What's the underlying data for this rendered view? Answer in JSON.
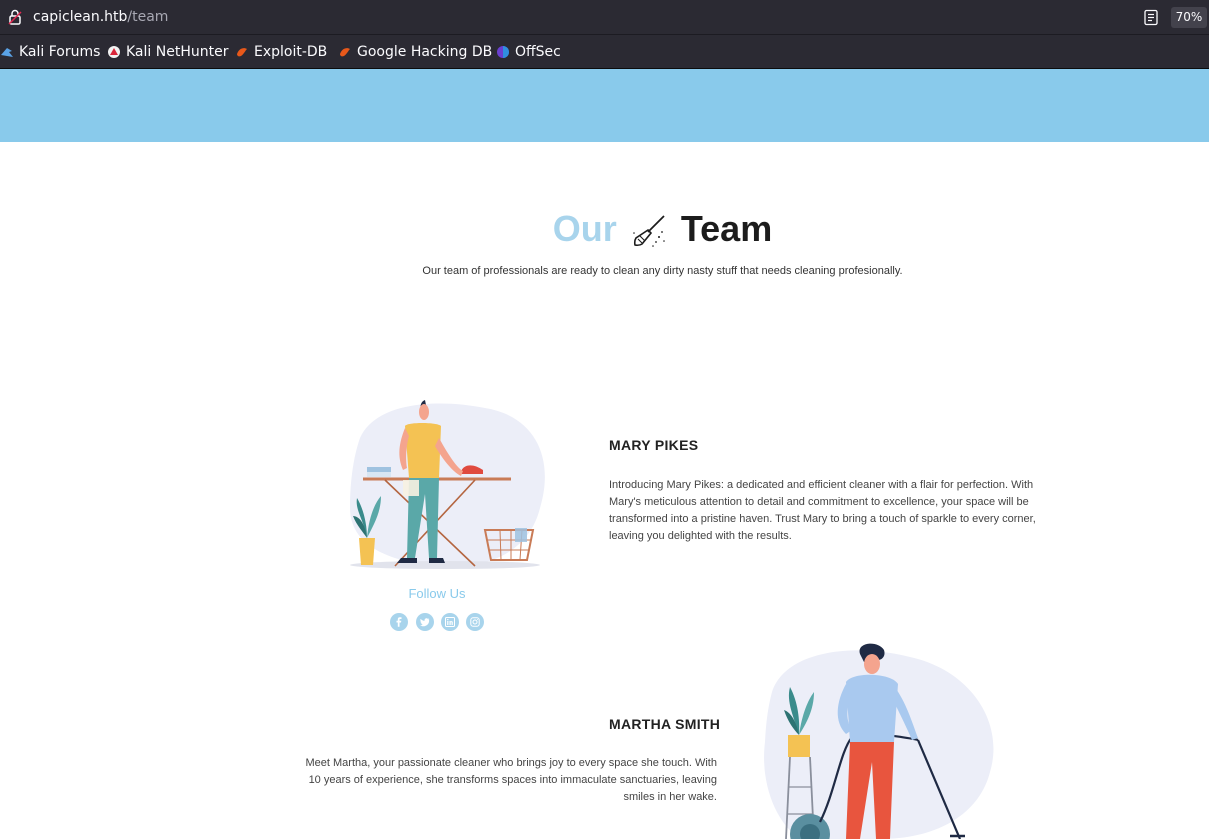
{
  "browser": {
    "url_host": "capiclean.htb",
    "url_path": "/team",
    "zoom": "70%",
    "bookmarks": [
      {
        "label": "Kali Forums",
        "icon": "kali-forums-icon"
      },
      {
        "label": "Kali NetHunter",
        "icon": "kali-nethunter-icon"
      },
      {
        "label": "Exploit-DB",
        "icon": "exploit-db-icon"
      },
      {
        "label": "Google Hacking DB",
        "icon": "google-hacking-db-icon"
      },
      {
        "label": "OffSec",
        "icon": "offsec-icon"
      }
    ]
  },
  "colors": {
    "hero_band": "#89caeb",
    "accent_light": "#a8d4ec",
    "title_dark": "#1c1c1c"
  },
  "section": {
    "title_part1": "Our",
    "title_part2": "Team",
    "subtitle": "Our team of professionals are ready to clean any dirty nasty stuff that needs cleaning profesionally."
  },
  "members": [
    {
      "name": "MARY PIKES",
      "bio": "Introducing Mary Pikes: a dedicated and efficient cleaner with a flair for perfection. With Mary's meticulous attention to detail and commitment to excellence, your space will be transformed into a pristine haven. Trust Mary to bring a touch of sparkle to every corner, leaving you delighted with the results."
    },
    {
      "name": "MARTHA SMITH",
      "bio": "Meet Martha, your passionate cleaner who brings joy to every space she touch. With 10 years of experience, she transforms spaces into immaculate sanctuaries, leaving smiles in her wake."
    }
  ],
  "follow": {
    "label": "Follow Us",
    "icons": [
      "facebook-icon",
      "twitter-icon",
      "linkedin-icon",
      "instagram-icon"
    ]
  }
}
